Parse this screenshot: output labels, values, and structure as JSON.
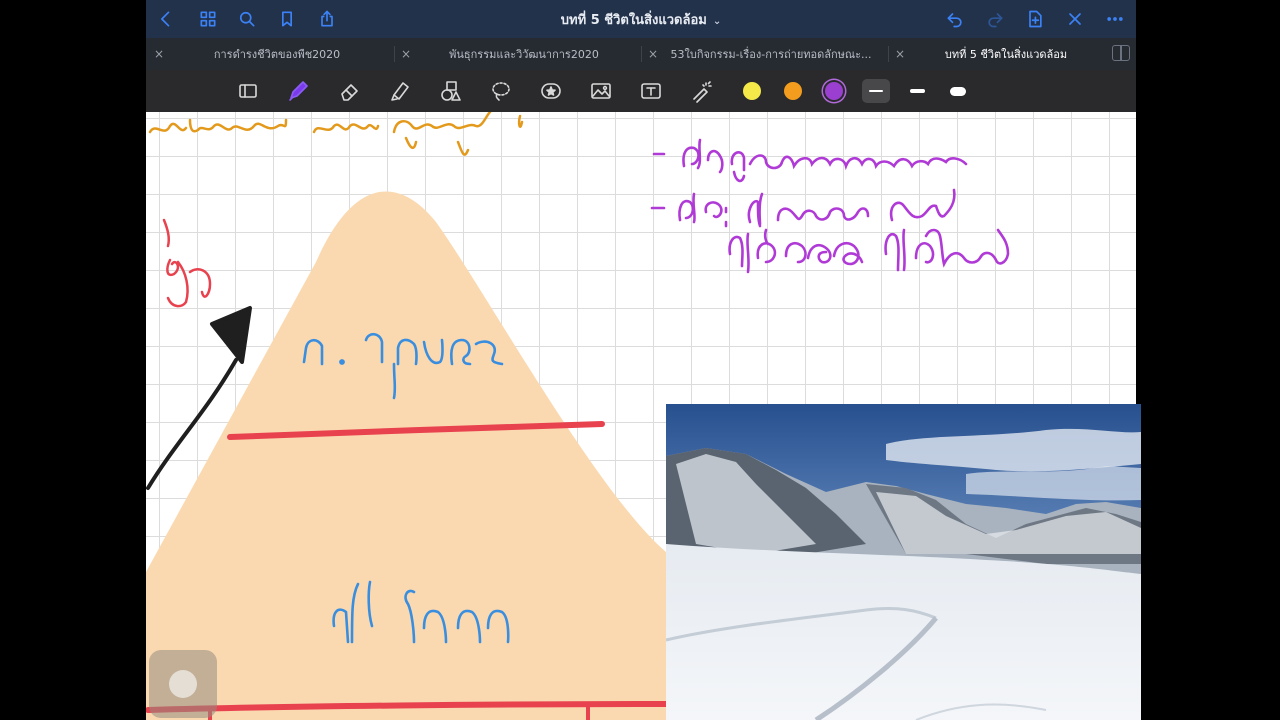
{
  "header": {
    "title": "บทที่ 5 ชีวิตในสิ่งแวดล้อม",
    "title_chevron": "⌄"
  },
  "tabs": [
    {
      "label": "การดำรงชีวิตของพืช2020",
      "close": "×",
      "active": false
    },
    {
      "label": "พันธุกรรมและวิวัฒนาการ2020",
      "close": "×",
      "active": false
    },
    {
      "label": "53ใบกิจกรรม-เรื่อง-การถ่ายทอดลักษณะ...",
      "close": "×",
      "active": false
    },
    {
      "label": "บทที่ 5 ชีวิตในสิ่งแวดล้อม",
      "close": "×",
      "active": true
    }
  ],
  "colors": {
    "accent": "#3b82f6",
    "pen_yellow": "#f5e94a",
    "pen_orange": "#f39c1e",
    "pen_purple": "#9b3fd1",
    "ink_red": "#e8424f",
    "ink_blue": "#3a8ee0",
    "ink_purple": "#b03ad6",
    "ink_orange": "#e39a1c",
    "mountain_fill": "#fbd9b0"
  },
  "toolbar": {
    "tools": [
      "page-view-icon",
      "pen-icon",
      "eraser-icon",
      "highlighter-icon",
      "shapes-icon",
      "lasso-icon",
      "sticker-icon",
      "image-icon",
      "text-icon",
      "laser-pointer-icon"
    ],
    "selected_tool": "pen-icon",
    "selected_color": "purple"
  }
}
